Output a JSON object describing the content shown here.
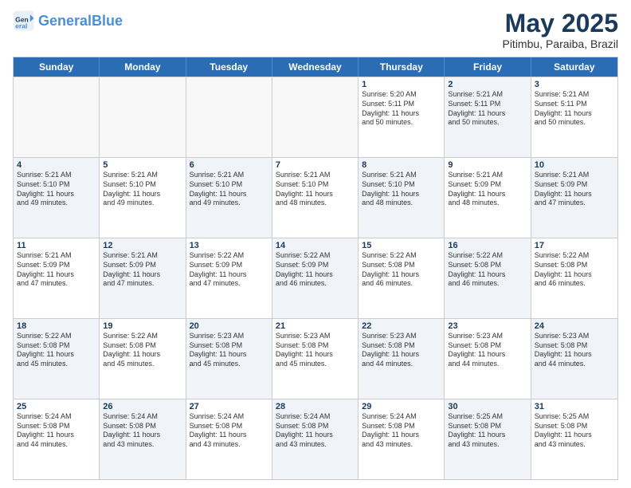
{
  "header": {
    "logo_general": "General",
    "logo_blue": "Blue",
    "month": "May 2025",
    "location": "Pitimbu, Paraiba, Brazil"
  },
  "weekdays": [
    "Sunday",
    "Monday",
    "Tuesday",
    "Wednesday",
    "Thursday",
    "Friday",
    "Saturday"
  ],
  "rows": [
    [
      {
        "day": "",
        "info": "",
        "shaded": false,
        "empty": true
      },
      {
        "day": "",
        "info": "",
        "shaded": false,
        "empty": true
      },
      {
        "day": "",
        "info": "",
        "shaded": false,
        "empty": true
      },
      {
        "day": "",
        "info": "",
        "shaded": false,
        "empty": true
      },
      {
        "day": "1",
        "info": "Sunrise: 5:20 AM\nSunset: 5:11 PM\nDaylight: 11 hours\nand 50 minutes.",
        "shaded": false,
        "empty": false
      },
      {
        "day": "2",
        "info": "Sunrise: 5:21 AM\nSunset: 5:11 PM\nDaylight: 11 hours\nand 50 minutes.",
        "shaded": true,
        "empty": false
      },
      {
        "day": "3",
        "info": "Sunrise: 5:21 AM\nSunset: 5:11 PM\nDaylight: 11 hours\nand 50 minutes.",
        "shaded": false,
        "empty": false
      }
    ],
    [
      {
        "day": "4",
        "info": "Sunrise: 5:21 AM\nSunset: 5:10 PM\nDaylight: 11 hours\nand 49 minutes.",
        "shaded": true,
        "empty": false
      },
      {
        "day": "5",
        "info": "Sunrise: 5:21 AM\nSunset: 5:10 PM\nDaylight: 11 hours\nand 49 minutes.",
        "shaded": false,
        "empty": false
      },
      {
        "day": "6",
        "info": "Sunrise: 5:21 AM\nSunset: 5:10 PM\nDaylight: 11 hours\nand 49 minutes.",
        "shaded": true,
        "empty": false
      },
      {
        "day": "7",
        "info": "Sunrise: 5:21 AM\nSunset: 5:10 PM\nDaylight: 11 hours\nand 48 minutes.",
        "shaded": false,
        "empty": false
      },
      {
        "day": "8",
        "info": "Sunrise: 5:21 AM\nSunset: 5:10 PM\nDaylight: 11 hours\nand 48 minutes.",
        "shaded": true,
        "empty": false
      },
      {
        "day": "9",
        "info": "Sunrise: 5:21 AM\nSunset: 5:09 PM\nDaylight: 11 hours\nand 48 minutes.",
        "shaded": false,
        "empty": false
      },
      {
        "day": "10",
        "info": "Sunrise: 5:21 AM\nSunset: 5:09 PM\nDaylight: 11 hours\nand 47 minutes.",
        "shaded": true,
        "empty": false
      }
    ],
    [
      {
        "day": "11",
        "info": "Sunrise: 5:21 AM\nSunset: 5:09 PM\nDaylight: 11 hours\nand 47 minutes.",
        "shaded": false,
        "empty": false
      },
      {
        "day": "12",
        "info": "Sunrise: 5:21 AM\nSunset: 5:09 PM\nDaylight: 11 hours\nand 47 minutes.",
        "shaded": true,
        "empty": false
      },
      {
        "day": "13",
        "info": "Sunrise: 5:22 AM\nSunset: 5:09 PM\nDaylight: 11 hours\nand 47 minutes.",
        "shaded": false,
        "empty": false
      },
      {
        "day": "14",
        "info": "Sunrise: 5:22 AM\nSunset: 5:09 PM\nDaylight: 11 hours\nand 46 minutes.",
        "shaded": true,
        "empty": false
      },
      {
        "day": "15",
        "info": "Sunrise: 5:22 AM\nSunset: 5:08 PM\nDaylight: 11 hours\nand 46 minutes.",
        "shaded": false,
        "empty": false
      },
      {
        "day": "16",
        "info": "Sunrise: 5:22 AM\nSunset: 5:08 PM\nDaylight: 11 hours\nand 46 minutes.",
        "shaded": true,
        "empty": false
      },
      {
        "day": "17",
        "info": "Sunrise: 5:22 AM\nSunset: 5:08 PM\nDaylight: 11 hours\nand 46 minutes.",
        "shaded": false,
        "empty": false
      }
    ],
    [
      {
        "day": "18",
        "info": "Sunrise: 5:22 AM\nSunset: 5:08 PM\nDaylight: 11 hours\nand 45 minutes.",
        "shaded": true,
        "empty": false
      },
      {
        "day": "19",
        "info": "Sunrise: 5:22 AM\nSunset: 5:08 PM\nDaylight: 11 hours\nand 45 minutes.",
        "shaded": false,
        "empty": false
      },
      {
        "day": "20",
        "info": "Sunrise: 5:23 AM\nSunset: 5:08 PM\nDaylight: 11 hours\nand 45 minutes.",
        "shaded": true,
        "empty": false
      },
      {
        "day": "21",
        "info": "Sunrise: 5:23 AM\nSunset: 5:08 PM\nDaylight: 11 hours\nand 45 minutes.",
        "shaded": false,
        "empty": false
      },
      {
        "day": "22",
        "info": "Sunrise: 5:23 AM\nSunset: 5:08 PM\nDaylight: 11 hours\nand 44 minutes.",
        "shaded": true,
        "empty": false
      },
      {
        "day": "23",
        "info": "Sunrise: 5:23 AM\nSunset: 5:08 PM\nDaylight: 11 hours\nand 44 minutes.",
        "shaded": false,
        "empty": false
      },
      {
        "day": "24",
        "info": "Sunrise: 5:23 AM\nSunset: 5:08 PM\nDaylight: 11 hours\nand 44 minutes.",
        "shaded": true,
        "empty": false
      }
    ],
    [
      {
        "day": "25",
        "info": "Sunrise: 5:24 AM\nSunset: 5:08 PM\nDaylight: 11 hours\nand 44 minutes.",
        "shaded": false,
        "empty": false
      },
      {
        "day": "26",
        "info": "Sunrise: 5:24 AM\nSunset: 5:08 PM\nDaylight: 11 hours\nand 43 minutes.",
        "shaded": true,
        "empty": false
      },
      {
        "day": "27",
        "info": "Sunrise: 5:24 AM\nSunset: 5:08 PM\nDaylight: 11 hours\nand 43 minutes.",
        "shaded": false,
        "empty": false
      },
      {
        "day": "28",
        "info": "Sunrise: 5:24 AM\nSunset: 5:08 PM\nDaylight: 11 hours\nand 43 minutes.",
        "shaded": true,
        "empty": false
      },
      {
        "day": "29",
        "info": "Sunrise: 5:24 AM\nSunset: 5:08 PM\nDaylight: 11 hours\nand 43 minutes.",
        "shaded": false,
        "empty": false
      },
      {
        "day": "30",
        "info": "Sunrise: 5:25 AM\nSunset: 5:08 PM\nDaylight: 11 hours\nand 43 minutes.",
        "shaded": true,
        "empty": false
      },
      {
        "day": "31",
        "info": "Sunrise: 5:25 AM\nSunset: 5:08 PM\nDaylight: 11 hours\nand 43 minutes.",
        "shaded": false,
        "empty": false
      }
    ]
  ]
}
